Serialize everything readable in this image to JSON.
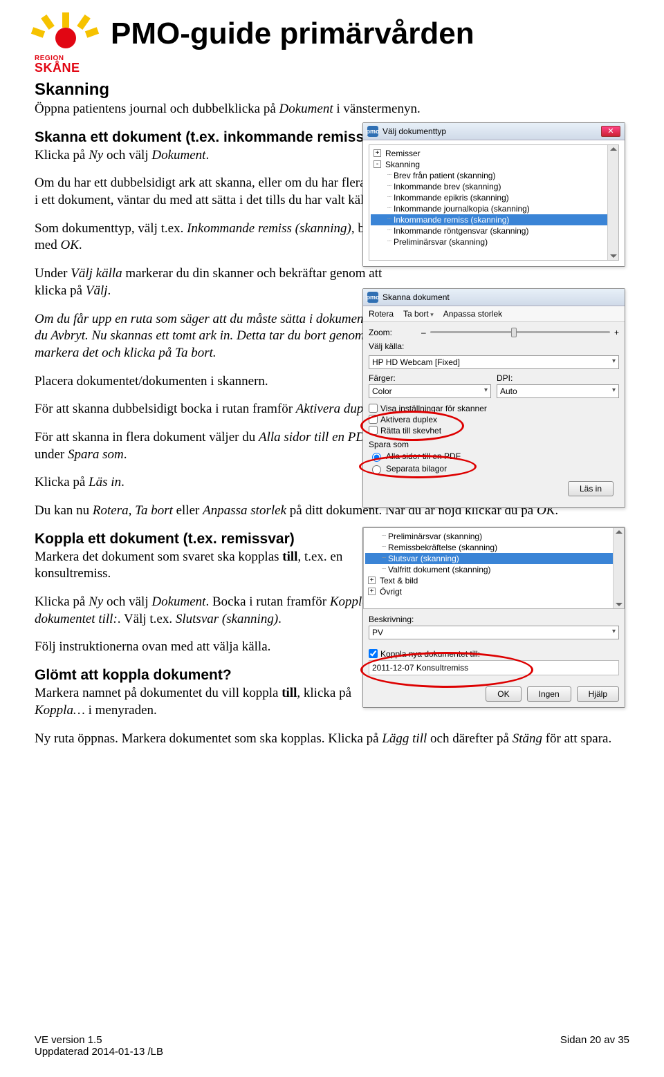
{
  "header": {
    "logo_region": "REGION",
    "logo_name": "SKÅNE",
    "title": "PMO-guide primärvården"
  },
  "sections": {
    "skanning_h": "Skanning",
    "skanning_p": "Öppna patientens journal och dubbelklicka på <i>Dokument</i> i vänstermenyn.",
    "skanna_h": "Skanna ett dokument (t.ex. inkommande remiss)",
    "skanna_p1": "Klicka på <i>Ny</i> och välj <i>Dokument</i>.",
    "skanna_p2": "Om du har ett dubbelsidigt ark att skanna, eller om du har flera sidor i ett dokument, väntar du med att sätta i det tills du har valt källa.",
    "skanna_p3": "Som dokumenttyp, välj t.ex. <i>Inkommande remiss (skanning)</i>, bekräfta med <i>OK</i>.",
    "skanna_p4": "Under <i>Välj källa</i> markerar du din skanner och bekräftar genom att klicka på <i>Välj</i>.",
    "skanna_p5": "<i>Om du får upp en ruta som säger att du måste sätta i dokument väljer du Avbryt. Nu skannas ett tomt ark in. Detta tar du bort genom att markera det och klicka på Ta bort.</i>",
    "skanna_p6": "Placera dokumentet/dokumenten i skannern.",
    "skanna_p7": "För att skanna dubbelsidigt bocka i rutan framför <i>Aktivera duplex</i>.",
    "skanna_p8": "För att skanna in flera dokument väljer du <i>Alla sidor till en PDF</i> under <i>Spara som</i>.",
    "skanna_p9": "Klicka på <i>Läs in</i>.",
    "skanna_p10": "Du kan nu <i>Rotera, Ta bort</i> eller <i>Anpassa storlek</i> på ditt dokument. När du är nöjd klickar du på <i>OK</i>.",
    "koppla_h": "Koppla ett dokument (t.ex. remissvar)",
    "koppla_p1": "Markera det dokument som svaret ska kopplas <b>till</b>, t.ex. en konsultremiss.",
    "koppla_p2": "Klicka på <i>Ny</i> och välj <i>Dokument</i>. Bocka i rutan framför <i>Koppla nya dokumentet till:</i>. Välj t.ex. <i>Slutsvar (skanning)</i>.",
    "koppla_p3": "Följ instruktionerna ovan med att välja källa.",
    "glomt_h": "Glömt att koppla dokument?",
    "glomt_p1": "Markera namnet på dokumentet du vill koppla <b>till</b>, klicka på <i>Koppla…</i> i menyraden.",
    "glomt_p2": "Ny ruta öppnas. Markera dokumentet som ska kopplas. Klicka på <i>Lägg till</i> och därefter på <i>Stäng</i> för att spara."
  },
  "dialog1": {
    "title": "Välj dokumenttyp",
    "items": [
      {
        "pm": "+",
        "txt": "Remisser",
        "indent": 0
      },
      {
        "pm": "-",
        "txt": "Skanning",
        "indent": 0
      },
      {
        "txt": "Brev från patient (skanning)",
        "indent": 1
      },
      {
        "txt": "Inkommande brev (skanning)",
        "indent": 1
      },
      {
        "txt": "Inkommande epikris (skanning)",
        "indent": 1
      },
      {
        "txt": "Inkommande journalkopia (skanning)",
        "indent": 1
      },
      {
        "txt": "Inkommande remiss (skanning)",
        "indent": 1,
        "sel": true
      },
      {
        "txt": "Inkommande röntgensvar (skanning)",
        "indent": 1
      },
      {
        "txt": "Preliminärsvar (skanning)",
        "indent": 1
      }
    ]
  },
  "dialog2": {
    "title": "Skanna dokument",
    "tb": [
      "Rotera",
      "Ta bort",
      "Anpassa storlek"
    ],
    "zoom": "Zoom:",
    "kalla_lbl": "Välj källa:",
    "kalla_val": "HP HD Webcam [Fixed]",
    "farger_lbl": "Färger:",
    "farger_val": "Color",
    "dpi_lbl": "DPI:",
    "dpi_val": "Auto",
    "chk1": "Visa inställningar för skanner",
    "chk2": "Aktivera duplex",
    "chk3": "Rätta till skevhet",
    "spara": "Spara som",
    "r1": "Alla sidor till en PDF",
    "r2": "Separata bilagor",
    "lasin": "Läs in"
  },
  "dialog3": {
    "items": [
      {
        "txt": "Preliminärsvar (skanning)",
        "indent": 1
      },
      {
        "txt": "Remissbekräftelse (skanning)",
        "indent": 1
      },
      {
        "txt": "Slutsvar (skanning)",
        "indent": 1,
        "sel": true
      },
      {
        "txt": "Valfritt dokument (skanning)",
        "indent": 1
      },
      {
        "pm": "+",
        "txt": "Text & bild",
        "indent": 0
      },
      {
        "pm": "+",
        "txt": "Övrigt",
        "indent": 0
      }
    ],
    "beskr_lbl": "Beskrivning:",
    "beskr_val": "PV",
    "koppla_chk": "Koppla nya dokumentet till:",
    "koppla_val": "2011-12-07 Konsultremiss",
    "ok": "OK",
    "ingen": "Ingen",
    "hjalp": "Hjälp"
  },
  "footer": {
    "left1": "VE version 1.5",
    "left2": "Uppdaterad 2014-01-13 /LB",
    "right": "Sidan 20 av 35"
  }
}
